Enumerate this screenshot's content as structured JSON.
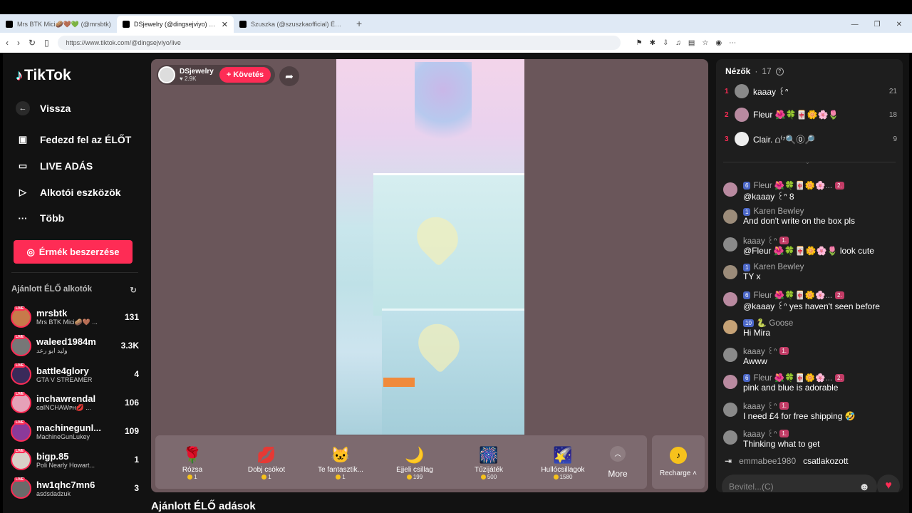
{
  "browser": {
    "tabs": [
      {
        "title": "Mrs BTK Mici🥔🤎💚 (@mrsbtk)"
      },
      {
        "title": "DSjewelry (@dingsejviyo) ÉLŐ"
      },
      {
        "title": "Szuszka (@szuszkaofficial) ÉLŐ adás"
      }
    ],
    "url": "https://www.tiktok.com/@dingsejviyo/live"
  },
  "sidebar": {
    "logo": "TikTok",
    "back": "Vissza",
    "nav": [
      "Fedezd fel az ÉLŐT",
      "LIVE ADÁS",
      "Alkotói eszközök",
      "Több"
    ],
    "coins_button": "Érmék beszerzése",
    "recommended_title": "Ajánlott ÉLŐ alkotók",
    "live_badge": "LIVE",
    "creators": [
      {
        "name": "mrsbtk",
        "sub": "Mrs BTK Mici🥔🤎 ...",
        "count": "131"
      },
      {
        "name": "waleed1984m",
        "sub": "وليد ابو رعد",
        "count": "3.3K"
      },
      {
        "name": "battle4glory",
        "sub": "GTA V STREAMER",
        "count": "4"
      },
      {
        "name": "inchawrendal",
        "sub": "ɢʙINCHAWᴘʜ💋 ...",
        "count": "106"
      },
      {
        "name": "machinegunl...",
        "sub": "MachineGunLukey",
        "count": "109"
      },
      {
        "name": "bigp.85",
        "sub": "Poli Nearly Howart...",
        "count": "1"
      },
      {
        "name": "hw1qhc7mn6",
        "sub": "asdsdadzuk",
        "count": "3"
      }
    ]
  },
  "stream": {
    "host_name": "DSjewelry",
    "host_likes": "2.9K",
    "follow_label": "Követés",
    "gifts": [
      {
        "name": "Rózsa",
        "price": "1",
        "icon": "🌹"
      },
      {
        "name": "Dobj csókot",
        "price": "1",
        "icon": "💋"
      },
      {
        "name": "Te fantasztik...",
        "price": "1",
        "icon": "🐱"
      },
      {
        "name": "Éjjeli csillag",
        "price": "199",
        "icon": "🌙"
      },
      {
        "name": "Tűzijáték",
        "price": "500",
        "icon": "🎆"
      },
      {
        "name": "Hullócsillagok",
        "price": "1580",
        "icon": "🌠"
      }
    ],
    "more_label": "More",
    "recharge_label": "Recharge",
    "below_title": "Ajánlott ÉLŐ adások"
  },
  "chat": {
    "viewers_label": "Nézők",
    "viewers_count": "17",
    "top": [
      {
        "rank": "1",
        "name": "kaaay ꒰ᐢ",
        "count": "21"
      },
      {
        "rank": "2",
        "name": "Fleur 🌺🍀🀄🌼🌸🌷",
        "count": "18"
      },
      {
        "rank": "3",
        "name": "Clair. ⩍⁽⁷🔍⓪🔎",
        "count": "9"
      }
    ],
    "messages": [
      {
        "user": "Fleur 🌺🍀🀄🌼🌸...",
        "lvl": "6",
        "extra": "2.",
        "text": "@kaaay ꒰ᐢ 8"
      },
      {
        "user": "Karen Bewley",
        "lvl": "1",
        "extra": "",
        "text": "And don't write on the box pls"
      },
      {
        "user": "kaaay ꒰ᐢ",
        "lvl": "1.",
        "extra": "",
        "text": "@Fleur 🌺🍀🀄🌼🌸🌷 look cute"
      },
      {
        "user": "Karen Bewley",
        "lvl": "1",
        "extra": "",
        "text": "TY x"
      },
      {
        "user": "Fleur 🌺🍀🀄🌼🌸...",
        "lvl": "6",
        "extra": "2.",
        "text": "@kaaay ꒰ᐢ yes haven't seen before"
      },
      {
        "user": "🐍 Goose",
        "lvl": "10",
        "extra": "",
        "text": "Hi Mira"
      },
      {
        "user": "kaaay ꒰ᐢ",
        "lvl": "1.",
        "extra": "",
        "text": "Awww"
      },
      {
        "user": "Fleur 🌺🍀🀄🌼🌸...",
        "lvl": "6",
        "extra": "2.",
        "text": "pink and blue is adorable"
      },
      {
        "user": "kaaay ꒰ᐢ",
        "lvl": "1.",
        "extra": "",
        "text": "I need £4 for free shipping 🤣"
      },
      {
        "user": "kaaay ꒰ᐢ",
        "lvl": "1.",
        "extra": "",
        "text": "Thinking what to get"
      }
    ],
    "join_user": "emmabee1980",
    "join_text": "csatlakozott",
    "input_placeholder": "Bevitel...(C)"
  }
}
